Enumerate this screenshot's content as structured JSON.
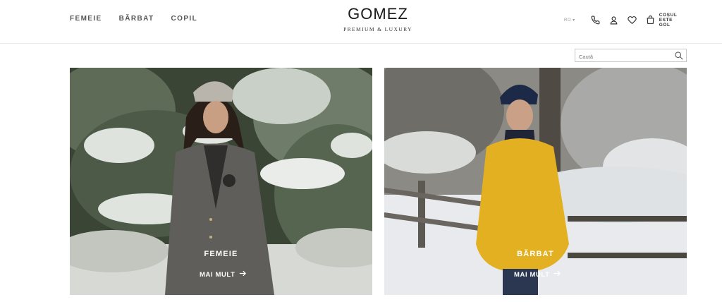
{
  "nav": {
    "items": [
      {
        "label": "FEMEIE"
      },
      {
        "label": "BĂRBAT"
      },
      {
        "label": "COPIL"
      }
    ]
  },
  "logo": {
    "name": "GOMEZ",
    "tagline": "PREMIUM & LUXURY"
  },
  "header_tools": {
    "language": "RO ▾",
    "phone_icon": "phone-icon",
    "account_icon": "user-icon",
    "wishlist_icon": "heart-icon",
    "cart_icon": "bag-icon",
    "cart_line1": "COȘUL",
    "cart_line2": "ESTE GOL"
  },
  "search": {
    "placeholder": "Caută",
    "icon": "search-icon"
  },
  "tiles": [
    {
      "title": "FEMEIE",
      "link": "MAI MULT"
    },
    {
      "title": "BĂRBAT",
      "link": "MAI MULT"
    }
  ],
  "colors": {
    "text": "#222222",
    "nav_text": "#555555",
    "border": "#ececec",
    "overlay_text": "#ffffff"
  }
}
